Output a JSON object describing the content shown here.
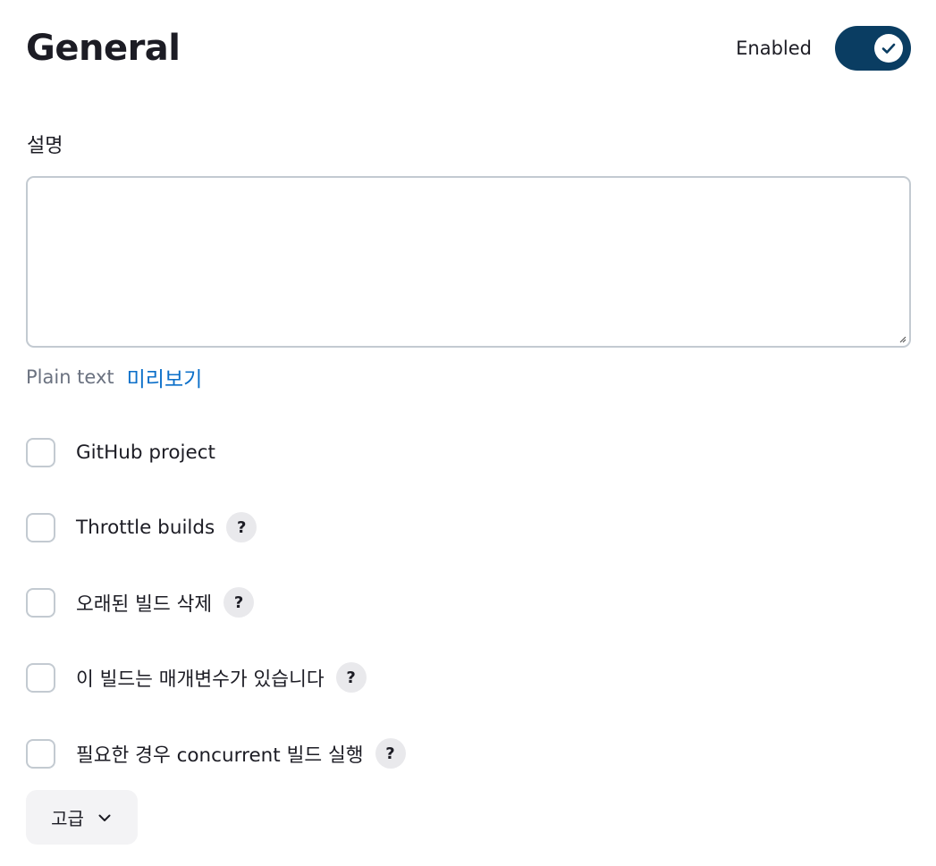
{
  "header": {
    "title": "General",
    "enabled_label": "Enabled",
    "enabled_state": true
  },
  "description": {
    "label": "설명",
    "value": "",
    "format_text": "Plain text",
    "preview_link": "미리보기"
  },
  "options": [
    {
      "label": "GitHub project",
      "checked": false,
      "has_help": false,
      "help_icon": ""
    },
    {
      "label": "Throttle builds",
      "checked": false,
      "has_help": true,
      "help_icon": "?"
    },
    {
      "label": "오래된 빌드 삭제",
      "checked": false,
      "has_help": true,
      "help_icon": "?"
    },
    {
      "label": "이 빌드는 매개변수가 있습니다",
      "checked": false,
      "has_help": true,
      "help_icon": "?"
    },
    {
      "label": "필요한 경우 concurrent 빌드 실행",
      "checked": false,
      "has_help": true,
      "help_icon": "?"
    }
  ],
  "advanced": {
    "label": "고급"
  },
  "colors": {
    "toggle_on": "#0a3d62",
    "link": "#0b6fc9",
    "border": "#c3cad1"
  }
}
